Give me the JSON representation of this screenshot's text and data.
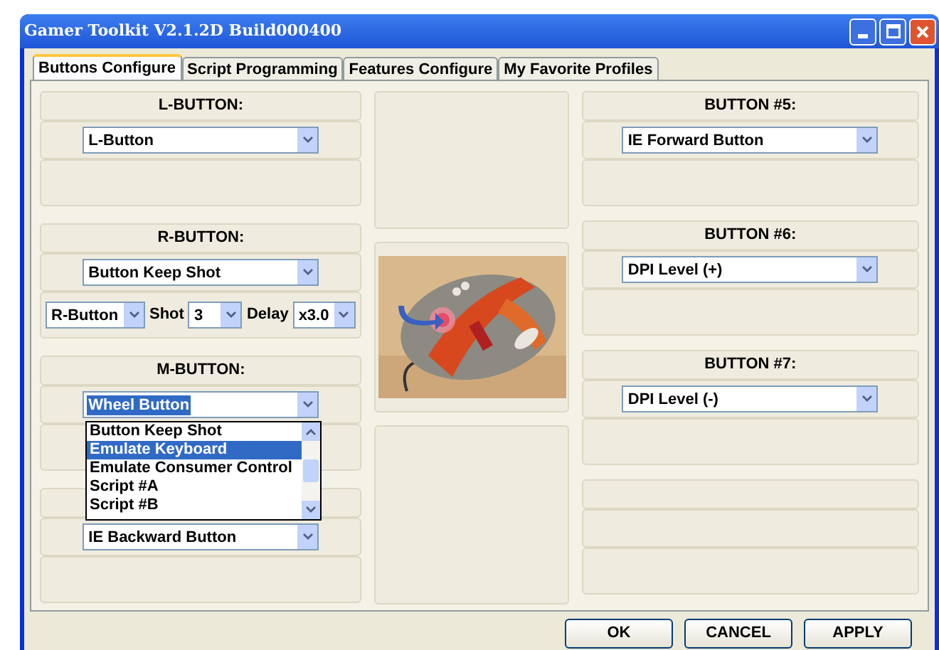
{
  "window": {
    "title": "Gamer Toolkit V2.1.2D Build000400"
  },
  "tabs": [
    {
      "label": "Buttons Configure",
      "selected": true
    },
    {
      "label": "Script Programming",
      "selected": false
    },
    {
      "label": "Features Configure",
      "selected": false
    },
    {
      "label": "My Favorite Profiles",
      "selected": false
    }
  ],
  "left_sections": [
    {
      "label": "L-BUTTON:",
      "select": {
        "value": "L-Button",
        "text_selected": false
      }
    },
    {
      "label": "R-BUTTON:",
      "select": {
        "value": "Button Keep Shot",
        "text_selected": false
      },
      "options_row": {
        "button_select": "R-Button",
        "shot_label": "Shot",
        "shot_select": "3",
        "delay_label": "Delay",
        "delay_select": "x3.0"
      }
    },
    {
      "label": "M-BUTTON:",
      "select": {
        "value": "Wheel Button",
        "text_selected": true
      },
      "open_list": [
        {
          "label": "Button Keep Shot",
          "selected": false
        },
        {
          "label": "Emulate Keyboard",
          "selected": true
        },
        {
          "label": "Emulate Consumer Control",
          "selected": false
        },
        {
          "label": "Script #A",
          "selected": false
        },
        {
          "label": "Script #B",
          "selected": false
        }
      ]
    },
    {
      "select": {
        "value": "IE Backward Button",
        "text_selected": false
      }
    }
  ],
  "right_sections": [
    {
      "label": "BUTTON #5:",
      "select": {
        "value": "IE Forward Button",
        "text_selected": false
      }
    },
    {
      "label": "BUTTON #6:",
      "select": {
        "value": "DPI Level (+)",
        "text_selected": false
      }
    },
    {
      "label": "BUTTON #7:",
      "select": {
        "value": "DPI Level (-)",
        "text_selected": false
      }
    }
  ],
  "buttons": [
    "OK",
    "CANCEL",
    "APPLY"
  ]
}
